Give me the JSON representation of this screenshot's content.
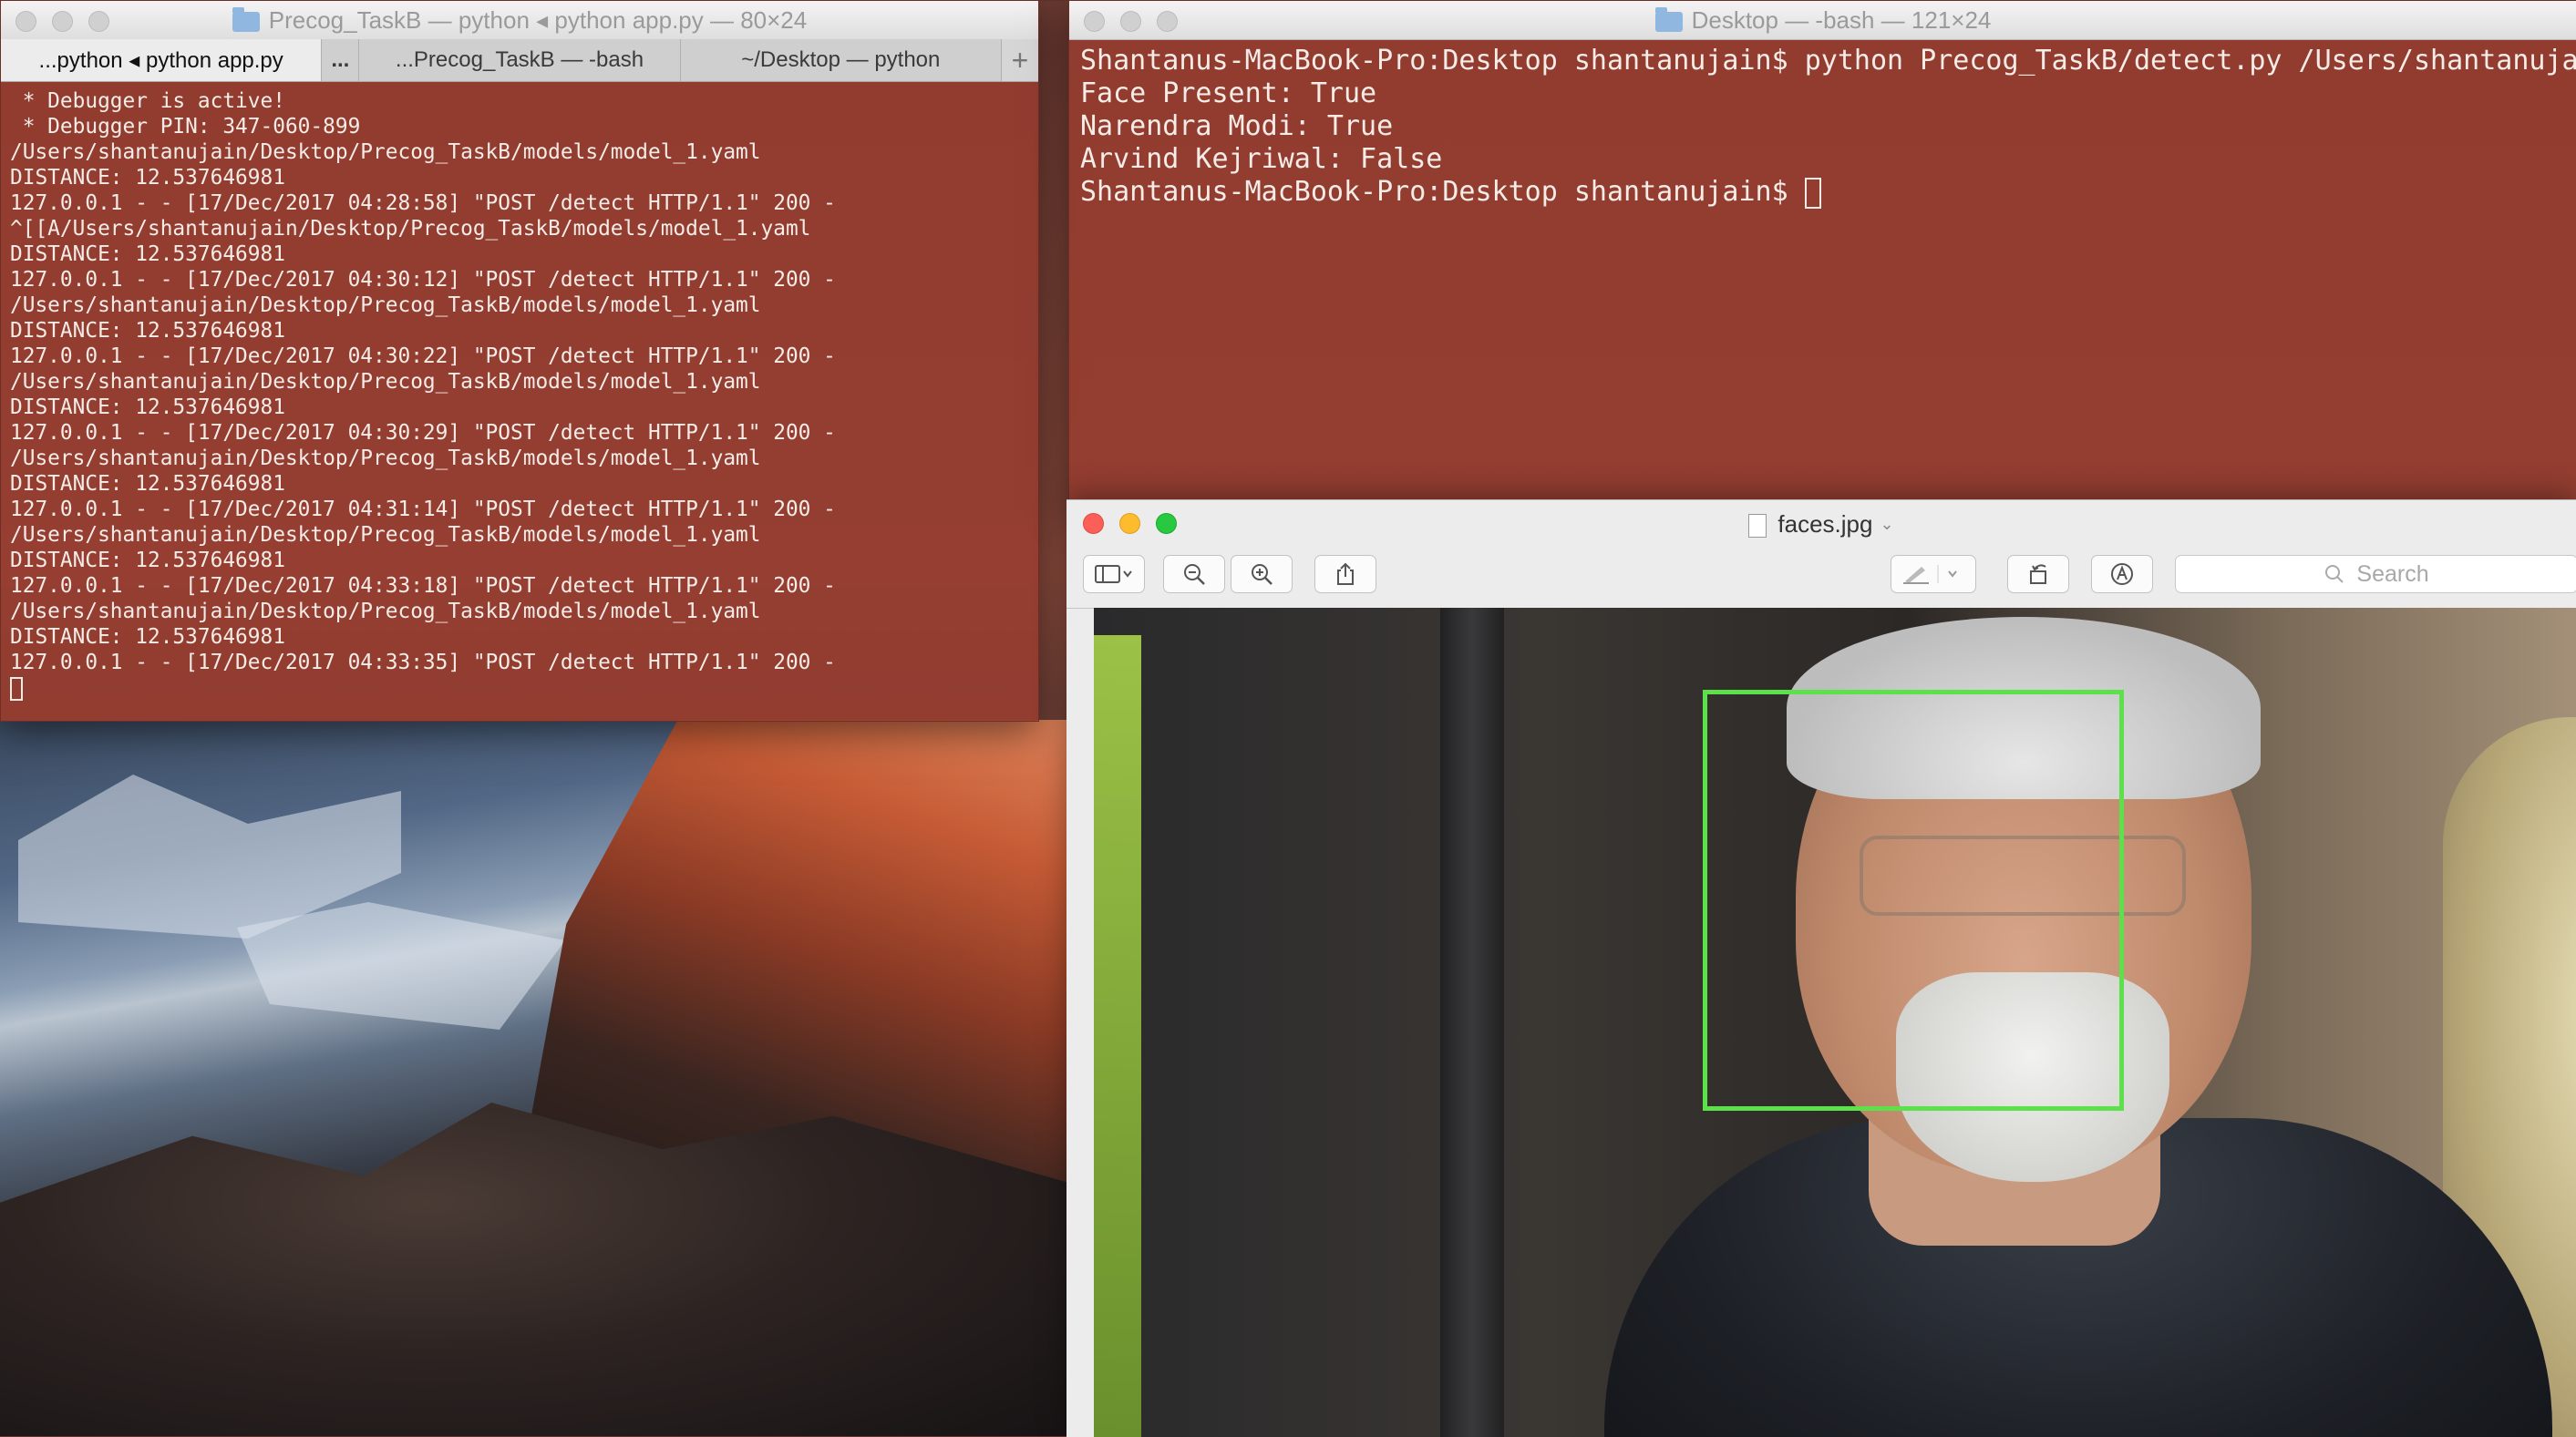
{
  "left_terminal": {
    "title": "Precog_TaskB — python ◂ python app.py — 80×24",
    "tabs": [
      {
        "label": "...python ◂ python app.py"
      },
      {
        "label": "..."
      },
      {
        "label": "...Precog_TaskB — -bash"
      },
      {
        "label": "~/Desktop — python"
      },
      {
        "label": "+"
      }
    ],
    "lines": [
      " * Debugger is active!",
      " * Debugger PIN: 347-060-899",
      "/Users/shantanujain/Desktop/Precog_TaskB/models/model_1.yaml",
      "DISTANCE: 12.537646981",
      "127.0.0.1 - - [17/Dec/2017 04:28:58] \"POST /detect HTTP/1.1\" 200 -",
      "^[[A/Users/shantanujain/Desktop/Precog_TaskB/models/model_1.yaml",
      "DISTANCE: 12.537646981",
      "127.0.0.1 - - [17/Dec/2017 04:30:12] \"POST /detect HTTP/1.1\" 200 -",
      "/Users/shantanujain/Desktop/Precog_TaskB/models/model_1.yaml",
      "DISTANCE: 12.537646981",
      "127.0.0.1 - - [17/Dec/2017 04:30:22] \"POST /detect HTTP/1.1\" 200 -",
      "/Users/shantanujain/Desktop/Precog_TaskB/models/model_1.yaml",
      "DISTANCE: 12.537646981",
      "127.0.0.1 - - [17/Dec/2017 04:30:29] \"POST /detect HTTP/1.1\" 200 -",
      "/Users/shantanujain/Desktop/Precog_TaskB/models/model_1.yaml",
      "DISTANCE: 12.537646981",
      "127.0.0.1 - - [17/Dec/2017 04:31:14] \"POST /detect HTTP/1.1\" 200 -",
      "/Users/shantanujain/Desktop/Precog_TaskB/models/model_1.yaml",
      "DISTANCE: 12.537646981",
      "127.0.0.1 - - [17/Dec/2017 04:33:18] \"POST /detect HTTP/1.1\" 200 -",
      "/Users/shantanujain/Desktop/Precog_TaskB/models/model_1.yaml",
      "DISTANCE: 12.537646981",
      "127.0.0.1 - - [17/Dec/2017 04:33:35] \"POST /detect HTTP/1.1\" 200 -"
    ]
  },
  "right_terminal": {
    "title": "Desktop — -bash — 121×24",
    "lines": [
      "Shantanus-MacBook-Pro:Desktop shantanujain$ python Precog_TaskB/detect.py /Users/shantanuja",
      "Face Present: True",
      "Narendra Modi: True",
      "Arvind Kejriwal: False",
      "Shantanus-MacBook-Pro:Desktop shantanujain$ "
    ]
  },
  "preview": {
    "title": "faces.jpg",
    "search_placeholder": "Search",
    "icons": {
      "sidebar": "sidebar-toggle-icon",
      "zoom_out": "zoom-out-icon",
      "zoom_in": "zoom-in-icon",
      "share": "share-icon",
      "markup_pen": "pen-icon",
      "rotate": "rotate-icon",
      "markup": "markup-icon",
      "search": "search-icon"
    }
  },
  "colors": {
    "terminal_bg": "#963c30",
    "face_box": "#5ce14a",
    "close": "#fc5f57",
    "minimize": "#fdbc2e",
    "zoom": "#28c840"
  }
}
